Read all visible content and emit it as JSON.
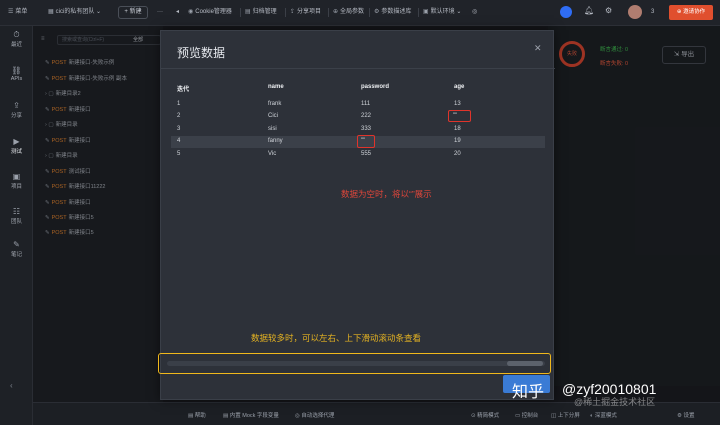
{
  "topbar": {
    "menu_label": "菜单",
    "team_label": "cici的私有团队",
    "new_label": "新建",
    "more": "···",
    "nav_items": [
      "Cookie管理器",
      "归档管理",
      "分享项目",
      "全局参数",
      "参数描述库",
      "默认环境"
    ],
    "badge_count": "3",
    "invite_label": "邀请协作"
  },
  "leftnav": {
    "items": [
      "最近",
      "APIs",
      "分享",
      "测试",
      "项目",
      "团队",
      "笔记"
    ]
  },
  "tree": {
    "search_placeholder": "搜索或查询(Ctrl+F)",
    "all_label": "全部",
    "items": [
      {
        "method": "POST",
        "label": "新建接口-失败示例"
      },
      {
        "method": "POST",
        "label": "新建接口-失败示例 副本"
      },
      {
        "method": "",
        "label": "新建目录2"
      },
      {
        "method": "POST",
        "label": "新建接口"
      },
      {
        "method": "",
        "label": "新建目录"
      },
      {
        "method": "POST",
        "label": "新建接口"
      },
      {
        "method": "",
        "label": "新建目录"
      },
      {
        "method": "POST",
        "label": "测试接口"
      },
      {
        "method": "POST",
        "label": "新建接口11222"
      },
      {
        "method": "POST",
        "label": "新建接口"
      },
      {
        "method": "POST",
        "label": "新建接口5"
      },
      {
        "method": "POST",
        "label": "新建接口5"
      }
    ]
  },
  "right": {
    "ring_label": "失败",
    "passed_label": "断言通过: 0",
    "failed_label": "断言失败: 0",
    "export_label": "导出"
  },
  "modal": {
    "title": "预览数据",
    "columns": [
      "迭代",
      "name",
      "password",
      "age"
    ],
    "rows": [
      [
        "1",
        "frank",
        "111",
        "13"
      ],
      [
        "2",
        "Cici",
        "222",
        "\"\""
      ],
      [
        "3",
        "sisi",
        "333",
        "18"
      ],
      [
        "4",
        "fanny",
        "\"\"",
        "19"
      ],
      [
        "5",
        "Vic",
        "555",
        "20"
      ]
    ],
    "annotation_red": "数据为空时，将以“”展示",
    "annotation_yellow": "数据较多时，可以左右、上下滑动滚动条查看"
  },
  "bottombar": {
    "items": [
      "帮助",
      "内置 Mock 字段变量",
      "自动选择代理",
      "精简模式",
      "控制台",
      "上下分屏",
      "深蓝模式",
      "设置"
    ]
  },
  "watermark": {
    "brand": "知乎",
    "handle": "@zyf20010801",
    "sub": "@稀土掘金技术社区"
  },
  "colors": {
    "accent_blue": "#2f6df5",
    "post_orange": "#e0822f",
    "error_red": "#e0342b",
    "highlight_yellow": "#f0b81c"
  }
}
